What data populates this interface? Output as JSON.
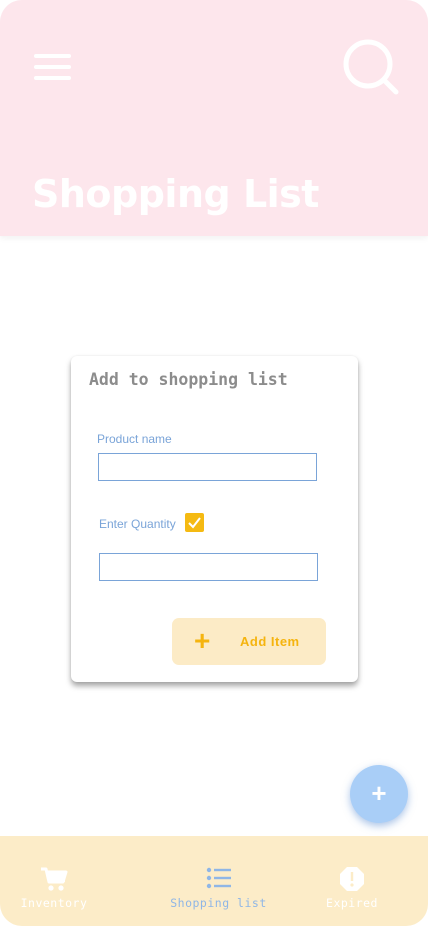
{
  "header": {
    "title": "Shopping List",
    "menu_icon": "hamburger-menu-icon",
    "search_icon": "search-icon",
    "background": "#fde6ec"
  },
  "dialog": {
    "title": "Add to shopping list",
    "product_label": "Product name",
    "product_value": "",
    "quantity_label": "Enter Quantity",
    "quantity_checked": true,
    "quantity_value": "",
    "add_button_label": "Add Item",
    "add_button_icon": "plus-icon",
    "accent": "#f5ba12",
    "field_border": "#7aa4d8"
  },
  "fab": {
    "icon": "plus-icon",
    "color": "#a9cef7"
  },
  "bottom_nav": {
    "background": "#fcecc8",
    "items": [
      {
        "label": "Inventory",
        "icon": "cart-icon",
        "active": false
      },
      {
        "label": "Shopping list",
        "icon": "list-icon",
        "active": true
      },
      {
        "label": "Expired",
        "icon": "alert-icon",
        "active": false
      }
    ]
  }
}
